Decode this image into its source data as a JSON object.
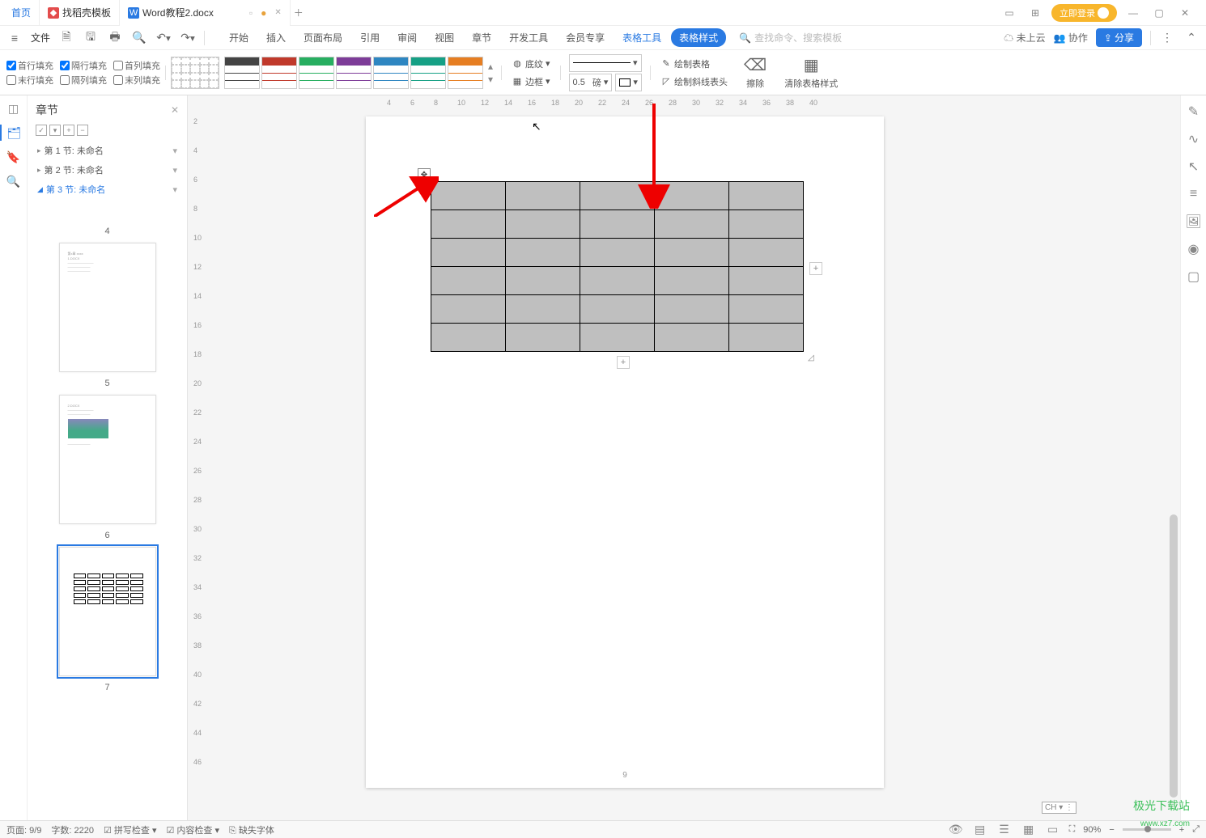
{
  "tabs": {
    "home": "首页",
    "t1": "找稻壳模板",
    "t2": "Word教程2.docx"
  },
  "login": "立即登录",
  "toolbar": {
    "file": "文件",
    "search_ph": "查找命令、搜索模板",
    "uncloud": "未上云",
    "collab": "协作",
    "share": "分享"
  },
  "ribbon": {
    "tabs": [
      "开始",
      "插入",
      "页面布局",
      "引用",
      "审阅",
      "视图",
      "章节",
      "开发工具",
      "会员专享"
    ],
    "context_tool": "表格工具",
    "context_style": "表格样式",
    "fill_first_row": "首行填充",
    "fill_alt_row": "隔行填充",
    "fill_first_col": "首列填充",
    "fill_last_row": "末行填充",
    "fill_alt_col": "隔列填充",
    "fill_last_col": "末列填充",
    "shading": "底纹",
    "border": "边框",
    "line_weight": "0.5",
    "line_unit": "磅",
    "draw_table": "绘制表格",
    "draw_diag": "绘制斜线表头",
    "eraser": "擦除",
    "clear_style": "清除表格样式"
  },
  "nav": {
    "title": "章节",
    "items": [
      {
        "label": "第 1 节: 未命名"
      },
      {
        "label": "第 2 节: 未命名"
      },
      {
        "label": "第 3 节: 未命名",
        "active": true
      }
    ],
    "thumbs": [
      "4",
      "5",
      "6",
      "7"
    ]
  },
  "ruler_h": [
    "4",
    "6",
    "8",
    "10",
    "12",
    "14",
    "16",
    "18",
    "20",
    "22",
    "24",
    "26",
    "28",
    "30",
    "32",
    "34",
    "36",
    "38",
    "40"
  ],
  "ruler_v": [
    "2",
    "4",
    "6",
    "8",
    "10",
    "12",
    "14",
    "16",
    "18",
    "20",
    "22",
    "24",
    "26",
    "28",
    "30",
    "32",
    "34",
    "36",
    "38",
    "40",
    "42",
    "44",
    "46"
  ],
  "page": {
    "num": "9"
  },
  "status": {
    "page": "页面: 9/9",
    "words": "字数: 2220",
    "spell": "拼写检查",
    "content": "内容检查",
    "font": "缺失字体",
    "zoom": "90%"
  },
  "watermark": "极光下载站",
  "watermark2": "www.xz7.com",
  "ch": "CH"
}
